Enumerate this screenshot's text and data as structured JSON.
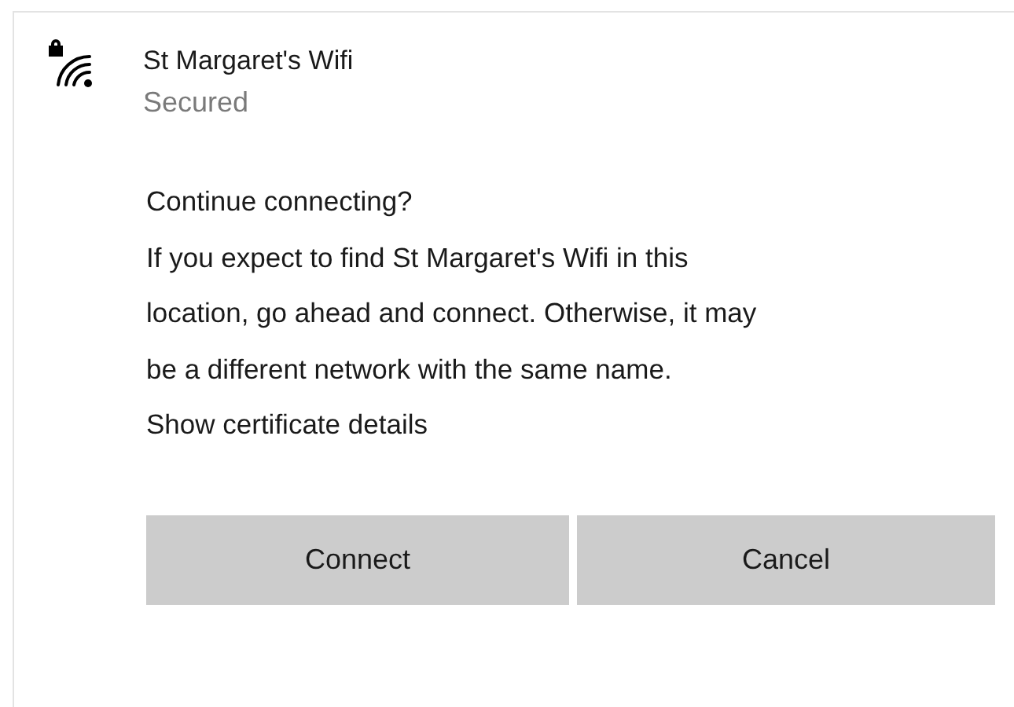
{
  "network": {
    "name": "St Margaret's Wifi",
    "status": "Secured",
    "secured": true
  },
  "prompt": {
    "heading": "Continue connecting?",
    "message": "If you expect to find St Margaret's Wifi in this location, go ahead and connect. Otherwise, it may be a different network with the same name.",
    "link": "Show certificate details"
  },
  "buttons": [
    "Connect",
    "Cancel"
  ]
}
